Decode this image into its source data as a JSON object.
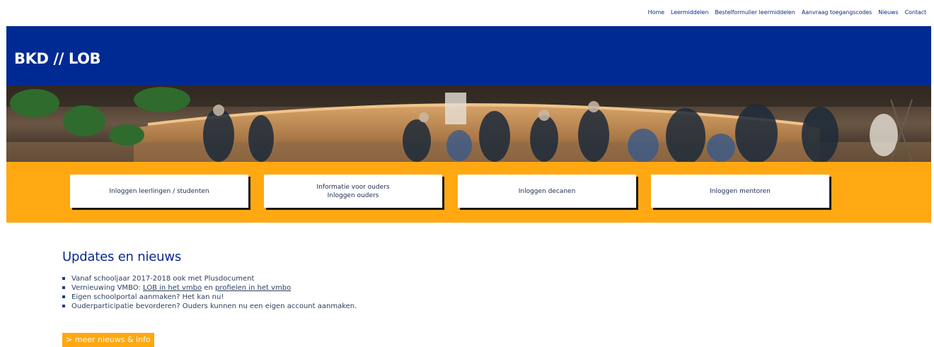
{
  "topnav": [
    {
      "label": "Home"
    },
    {
      "label": "Leermiddelen"
    },
    {
      "label": "Bestelformulier leermiddelen"
    },
    {
      "label": "Aanvraag toegangscodes"
    },
    {
      "label": "Nieuws"
    },
    {
      "label": "Contact"
    }
  ],
  "header": {
    "title": "BKD // LOB"
  },
  "tiles": [
    {
      "line1": "Inloggen leerlingen / studenten",
      "line2": ""
    },
    {
      "line1": "Informatie voor ouders",
      "line2": "Inloggen ouders"
    },
    {
      "line1": "Inloggen decanen",
      "line2": ""
    },
    {
      "line1": "Inloggen mentoren",
      "line2": ""
    }
  ],
  "news": {
    "heading": "Updates en nieuws",
    "items": [
      {
        "text": "Vanaf schooljaar 2017-2018 ook met Plusdocument"
      },
      {
        "prefix": "Vernieuwing VMBO: ",
        "link1": "LOB in het vmbo",
        "mid": " en ",
        "link2": "profielen in het vmbo"
      },
      {
        "text": "Eigen schoolportal aanmaken? Het kan nu!"
      },
      {
        "text": "Ouderparticipatie bevorderen? Ouders kunnen nu een eigen account aanmaken."
      }
    ],
    "more_label": "> meer nieuws & info"
  },
  "colors": {
    "header": "#002a93",
    "accent": "#ffa812",
    "link": "#0a2a8a"
  }
}
